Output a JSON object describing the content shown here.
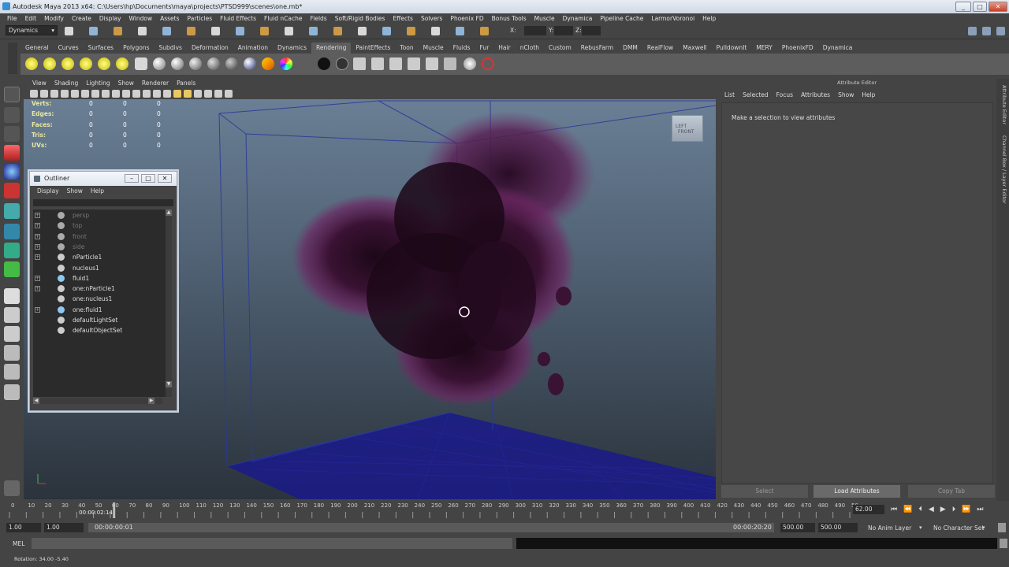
{
  "window": {
    "title": "Autodesk Maya 2013 x64: C:\\Users\\hp\\Documents\\maya\\projects\\PTSD999\\scenes\\one.mb*"
  },
  "menubar": [
    "File",
    "Edit",
    "Modify",
    "Create",
    "Display",
    "Window",
    "Assets",
    "Particles",
    "Fluid Effects",
    "Fluid nCache",
    "Fields",
    "Soft/Rigid Bodies",
    "Effects",
    "Solvers",
    "Phoenix FD",
    "Bonus Tools",
    "Muscle",
    "Dynamica",
    "Pipeline Cache",
    "LarmorVoronoi",
    "Help"
  ],
  "statusline": {
    "menu_set": "Dynamics",
    "x_label": "X:",
    "y_label": "Y:",
    "z_label": "Z:"
  },
  "shelf_tabs": {
    "items": [
      "General",
      "Curves",
      "Surfaces",
      "Polygons",
      "Subdivs",
      "Deformation",
      "Animation",
      "Dynamics",
      "Rendering",
      "PaintEffects",
      "Toon",
      "Muscle",
      "Fluids",
      "Fur",
      "Hair",
      "nCloth",
      "Custom",
      "RebusFarm",
      "DMM",
      "RealFlow",
      "Maxwell",
      "PulldownIt",
      "MERY",
      "PhoenixFD",
      "Dynamica"
    ],
    "active": "Rendering"
  },
  "panel_menu": [
    "View",
    "Shading",
    "Lighting",
    "Show",
    "Renderer",
    "Panels"
  ],
  "hud": {
    "rows": [
      {
        "label": "Verts:",
        "values": [
          "0",
          "0",
          "0"
        ]
      },
      {
        "label": "Edges:",
        "values": [
          "0",
          "0",
          "0"
        ]
      },
      {
        "label": "Faces:",
        "values": [
          "0",
          "0",
          "0"
        ]
      },
      {
        "label": "Tris:",
        "values": [
          "0",
          "0",
          "0"
        ]
      },
      {
        "label": "UVs:",
        "values": [
          "0",
          "0",
          "0"
        ]
      }
    ]
  },
  "viewcube": {
    "left": "LEFT",
    "front": "FRONT"
  },
  "outliner": {
    "title": "Outliner",
    "menu": [
      "Display",
      "Show",
      "Help"
    ],
    "items": [
      {
        "label": "persp",
        "expandable": true,
        "dim": true,
        "icon": "camera-icon"
      },
      {
        "label": "top",
        "expandable": true,
        "dim": true,
        "icon": "camera-icon"
      },
      {
        "label": "front",
        "expandable": true,
        "dim": true,
        "icon": "camera-icon"
      },
      {
        "label": "side",
        "expandable": true,
        "dim": true,
        "icon": "camera-icon"
      },
      {
        "label": "nParticle1",
        "expandable": true,
        "dim": false,
        "icon": "nparticle-icon"
      },
      {
        "label": "nucleus1",
        "expandable": false,
        "dim": false,
        "icon": "nucleus-icon"
      },
      {
        "label": "fluid1",
        "expandable": true,
        "dim": false,
        "icon": "fluid-icon"
      },
      {
        "label": "one:nParticle1",
        "expandable": true,
        "dim": false,
        "icon": "nparticle-icon"
      },
      {
        "label": "one:nucleus1",
        "expandable": false,
        "dim": false,
        "icon": "nucleus-icon"
      },
      {
        "label": "one:fluid1",
        "expandable": true,
        "dim": false,
        "icon": "fluid-icon"
      },
      {
        "label": "defaultLightSet",
        "expandable": false,
        "dim": false,
        "icon": "set-icon"
      },
      {
        "label": "defaultObjectSet",
        "expandable": false,
        "dim": false,
        "icon": "set-icon"
      }
    ]
  },
  "attribute_editor": {
    "title": "Attribute Editor",
    "menu": [
      "List",
      "Selected",
      "Focus",
      "Attributes",
      "Show",
      "Help"
    ],
    "message": "Make a selection to view attributes",
    "buttons": {
      "select": "Select",
      "load": "Load Attributes",
      "copy": "Copy Tab"
    },
    "side_tabs": [
      "Attribute Editor",
      "Channel Box / Layer Editor"
    ]
  },
  "timeslider": {
    "ticks": [
      "0",
      "10",
      "20",
      "30",
      "40",
      "50",
      "60",
      "70",
      "80",
      "90",
      "100",
      "110",
      "120",
      "130",
      "140",
      "150",
      "160",
      "170",
      "180",
      "190",
      "200",
      "210",
      "220",
      "230",
      "240",
      "250",
      "260",
      "270",
      "280",
      "290",
      "300",
      "310",
      "320",
      "330",
      "340",
      "350",
      "360",
      "370",
      "380",
      "390",
      "400",
      "410",
      "420",
      "430",
      "440",
      "450",
      "460",
      "470",
      "480",
      "490",
      "500"
    ],
    "current_timecode": "00:00:02:14",
    "current_frame": "62.00",
    "current_value": 62,
    "max": 500
  },
  "range": {
    "start": "1.00",
    "start_inner": "1.00",
    "start_time": "00:00:00:01",
    "end_time": "00:00:20:20",
    "end_inner": "500.00",
    "end": "500.00",
    "anim_layer": "No Anim Layer",
    "char_set": "No Character Set"
  },
  "command_line": {
    "label": "MEL"
  },
  "help_line": {
    "text": "Rotation: 34.00  -5.40"
  },
  "colors": {
    "accent": "#5d5d5d",
    "smoke": "#3a1233",
    "smoke_glow": "#7a2a6a",
    "grid": "#1a1a8a",
    "container": "#2a3a9a"
  }
}
